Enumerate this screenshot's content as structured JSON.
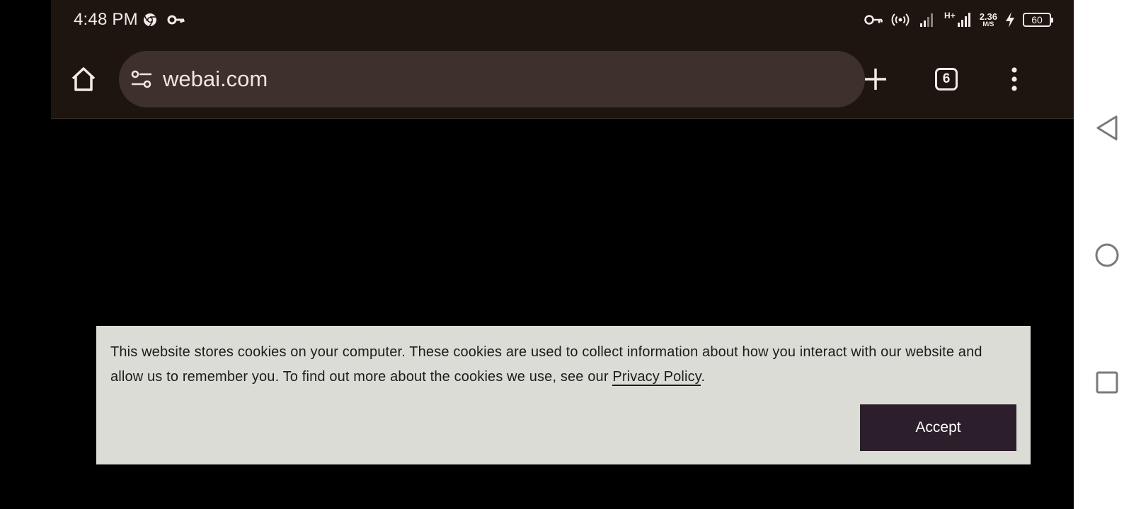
{
  "status_bar": {
    "time": "4:48 PM",
    "left_icons": [
      "chrome-icon",
      "key-icon"
    ],
    "right_icons": [
      "vpn-key-icon",
      "hotspot-icon",
      "signal-icon",
      "signal-hplus-icon",
      "charging-icon"
    ],
    "network_type": "H+",
    "net_speed_value": "2.36",
    "net_speed_unit": "M/S",
    "battery_level": "60"
  },
  "browser": {
    "url": "webai.com",
    "tab_count": "6",
    "icons": [
      "home-icon",
      "site-settings-icon",
      "new-tab-icon",
      "tab-switcher-icon",
      "more-menu-icon"
    ]
  },
  "cookie_banner": {
    "text_before_link": "This website stores cookies on your computer. These cookies are used to collect information about how you interact with our website and allow us to remember you. To find out more about the cookies we use, see our ",
    "link_text": "Privacy Policy",
    "text_after_link": ".",
    "accept_label": "Accept"
  },
  "nav_bar": {
    "icons": [
      "back-icon",
      "home-circle-icon",
      "recents-icon"
    ]
  },
  "colors": {
    "toolbar_bg": "#1e1410",
    "omnibox_bg": "#3e302a",
    "banner_bg": "#dcdcd7",
    "accept_bg": "#2c1f2b",
    "page_bg": "#000000"
  }
}
